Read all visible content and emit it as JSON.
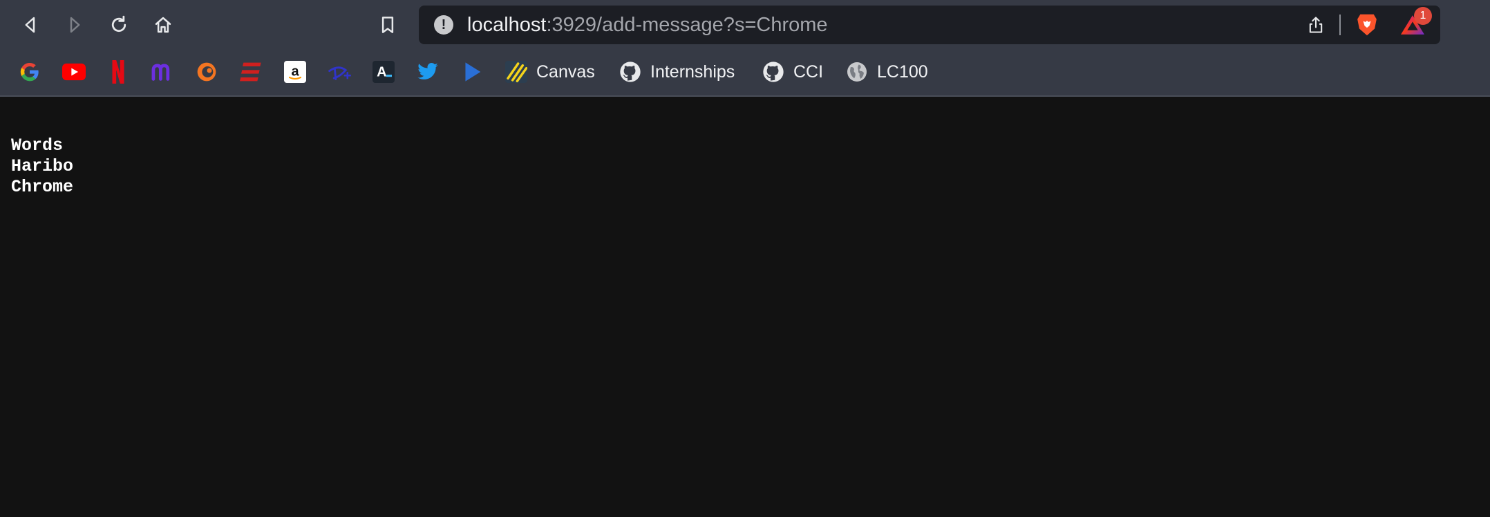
{
  "browser": {
    "url": {
      "host": "localhost",
      "rest": ":3929/add-message?s=Chrome"
    },
    "rewards_badge": "1",
    "bookmarks": [
      {
        "icon": "google-icon",
        "label": ""
      },
      {
        "icon": "youtube-icon",
        "label": ""
      },
      {
        "icon": "netflix-icon",
        "label": ""
      },
      {
        "icon": "mastodon-icon",
        "label": ""
      },
      {
        "icon": "crunchyroll-icon",
        "label": ""
      },
      {
        "icon": "espn-icon",
        "label": ""
      },
      {
        "icon": "amazon-icon",
        "label": ""
      },
      {
        "icon": "disney-plus-icon",
        "label": ""
      },
      {
        "icon": "anilist-icon",
        "label": ""
      },
      {
        "icon": "twitter-icon",
        "label": ""
      },
      {
        "icon": "play-icon",
        "label": ""
      },
      {
        "icon": "canvas-icon",
        "label": "Canvas"
      },
      {
        "icon": "github-icon",
        "label": "Internships"
      },
      {
        "icon": "github-icon",
        "label": "CCI"
      },
      {
        "icon": "globe-icon",
        "label": "LC100"
      }
    ]
  },
  "page": {
    "lines": [
      "Words",
      "Haribo",
      "Chrome"
    ]
  },
  "colors": {
    "chrome": "#363a45",
    "urlbar": "#1c1e24",
    "page_bg": "#121212",
    "badge": "#e0493b"
  }
}
